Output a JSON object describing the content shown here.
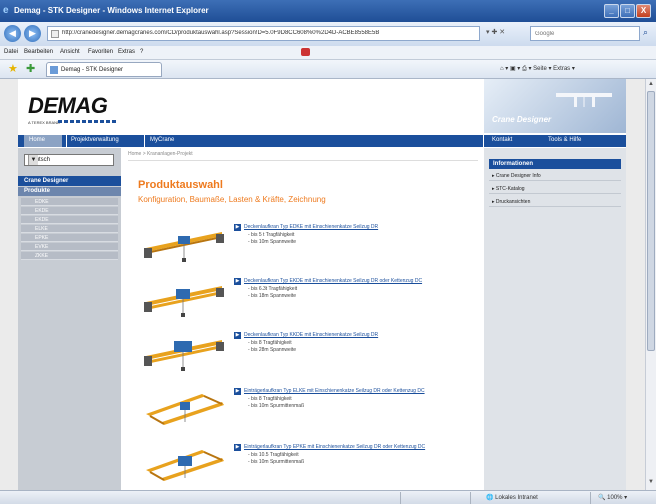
{
  "window": {
    "title": "Demag - STK Designer - Windows Internet Explorer",
    "minimize": "_",
    "maximize": "□",
    "close": "X"
  },
  "address": {
    "url": "http://cranedesigner.demagcranes.com/CD/produktauswahl.asp?Session!D=5.0F9D8CC608%0%2D4D-ACBE8558E5B",
    "tools": "▾ ✚ ✕",
    "search_placeholder": "Google"
  },
  "menu": [
    "Datei",
    "Bearbeiten",
    "Ansicht",
    "Favoriten",
    "Extras",
    "?"
  ],
  "tab": {
    "label": "Demag - STK Designer"
  },
  "command_bar": "⌂ ▾ ▣ ▾ ⎙ ▾ Seite ▾ Extras ▾",
  "site": {
    "logo": "DEMAG",
    "logo_tag": "A TEREX BRAND",
    "banner_title": "Crane Designer",
    "nav": [
      "Home",
      "Projektverwaltung",
      "MyCrane"
    ],
    "nav_right": [
      "Kontakt",
      "Tools & Hilfe"
    ]
  },
  "sidebar": {
    "language": "Deutsch",
    "header": "Crane Designer",
    "subheader": "Produkte",
    "items": [
      "EDKE",
      "EKDE",
      "EKDE",
      "ELKE",
      "EPKE",
      "EVKE",
      "ZKKE"
    ]
  },
  "main": {
    "breadcrumb": "Home > Krananlagen-Projekt",
    "title": "Produktauswahl",
    "subtitle": "Konfiguration, Baumaße, Lasten & Kräfte, Zeichnung",
    "products": [
      {
        "link": "Deckenlaufkran Typ EDKE mit Einschienenkatze Seilzug DR",
        "specs": [
          "- bis 5 t Tragfähigkeit",
          "- bis 10m Spannweite"
        ]
      },
      {
        "link": "Deckenlaufkran Typ EKDE mit Einschienenkatze Seilzug DR oder Kettenzug DC",
        "specs": [
          "- bis 6.3t Tragfähigkeit",
          "- bis 18m Spannweite"
        ]
      },
      {
        "link": "Deckenlaufkran Typ KKDE mit Einschienenkatze Seilzug DR",
        "specs": [
          "- bis 8 Tragfähigkeit",
          "- bis 28m Spannweite"
        ]
      },
      {
        "link": "Einträgerlaufkran Typ ELKE mit Einschienenkatze Seilzug DR oder Kettenzug DC",
        "specs": [
          "- bis 8 Tragfähigkeit",
          "- bis 10m Spurmittenmaß"
        ]
      },
      {
        "link": "Einträgerlaufkran Typ EPKE mit Einschienenkatze Seilzug DR oder Kettenzug DC",
        "specs": [
          "- bis 10.5 Tragfähigkeit",
          "- bis 10m Spurmittenmaß"
        ]
      }
    ]
  },
  "right": {
    "header": "Informationen",
    "links": [
      "Crane Designer Info",
      "STC-Katalog",
      "Druckansichten"
    ]
  },
  "status": {
    "zone": "Lokales Intranet",
    "zoom": "100%"
  },
  "colors": {
    "brand_blue": "#1b4f9c",
    "accent_orange": "#ee7a1e",
    "crane_yellow": "#e8a21e"
  }
}
